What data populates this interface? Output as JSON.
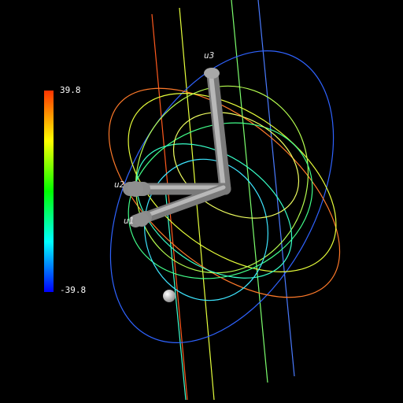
{
  "viewer": {
    "background": "#000000",
    "colorbar": {
      "max_label": "39.8",
      "min_label": "-39.8",
      "colors": [
        "#0000ff",
        "#00ffff",
        "#00ff00",
        "#ffff00",
        "#ff3300"
      ]
    },
    "nodes": [
      {
        "label": "u1"
      },
      {
        "label": "u2"
      },
      {
        "label": "u3"
      }
    ],
    "cylinder_color": "#9a9a9a",
    "ball_color": "#e8e8e8"
  }
}
